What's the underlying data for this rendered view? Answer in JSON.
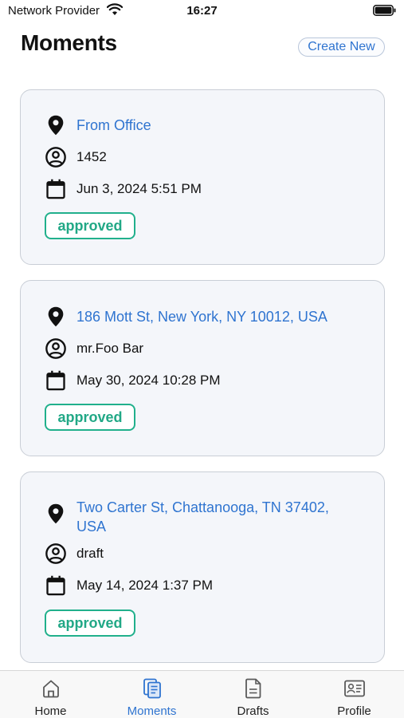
{
  "status_bar": {
    "carrier": "Network Provider",
    "time": "16:27"
  },
  "header": {
    "title": "Moments",
    "create_label": "Create New"
  },
  "colors": {
    "accent": "#2f74d0",
    "approved": "#21b08c",
    "card_bg": "#f4f6fa"
  },
  "moments": [
    {
      "location": "From Office",
      "user": "1452",
      "date": "Jun 3, 2024 5:51 PM",
      "status": "approved"
    },
    {
      "location": "186 Mott St, New York, NY 10012, USA",
      "user": "mr.Foo Bar",
      "date": "May 30, 2024 10:28 PM",
      "status": "approved"
    },
    {
      "location": "Two Carter St, Chattanooga, TN 37402, USA",
      "user": "draft",
      "date": "May 14, 2024 1:37 PM",
      "status": "approved"
    }
  ],
  "tabs": [
    {
      "label": "Home",
      "icon": "home-icon",
      "active": false
    },
    {
      "label": "Moments",
      "icon": "moments-icon",
      "active": true
    },
    {
      "label": "Drafts",
      "icon": "drafts-icon",
      "active": false
    },
    {
      "label": "Profile",
      "icon": "profile-icon",
      "active": false
    }
  ]
}
